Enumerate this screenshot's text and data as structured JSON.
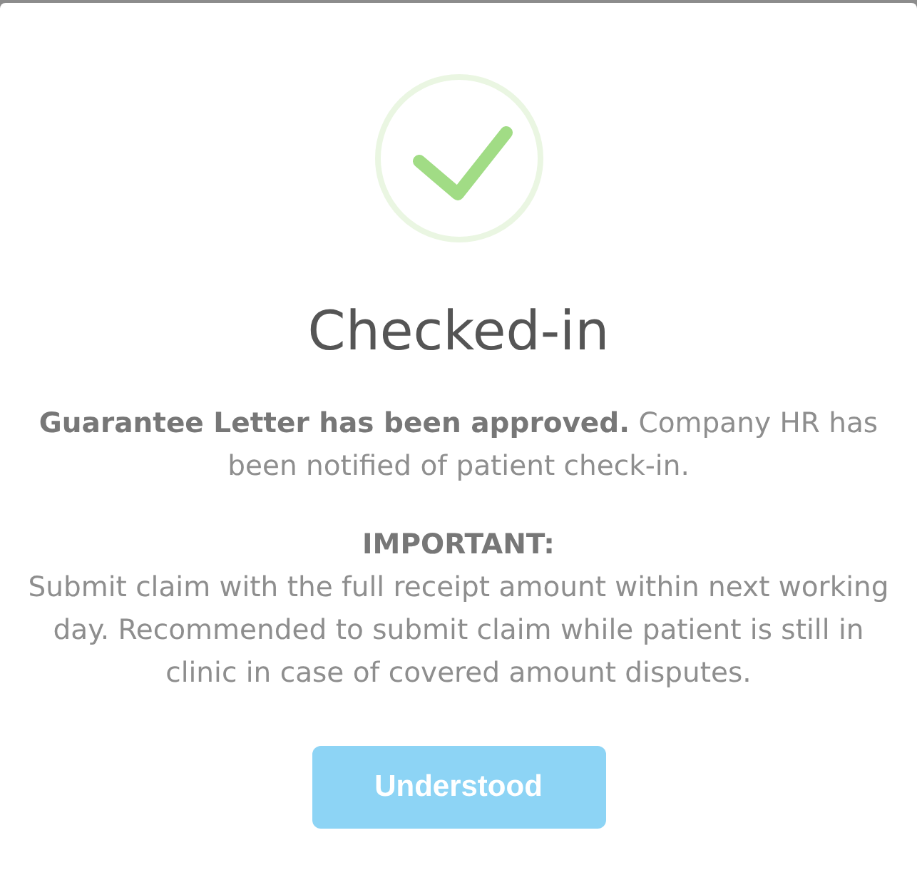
{
  "dialog": {
    "title": "Checked-in",
    "message": "**Guarantee Letter has been approved.** Company HR has been notified of patient check-in.",
    "notice": {
      "heading": "IMPORTANT:",
      "text": "Submit claim with the full receipt amount within next working day. Recommended to submit claim while patient is still in clinic in case of covered amount disputes."
    },
    "button": {
      "label": "Understood"
    }
  }
}
